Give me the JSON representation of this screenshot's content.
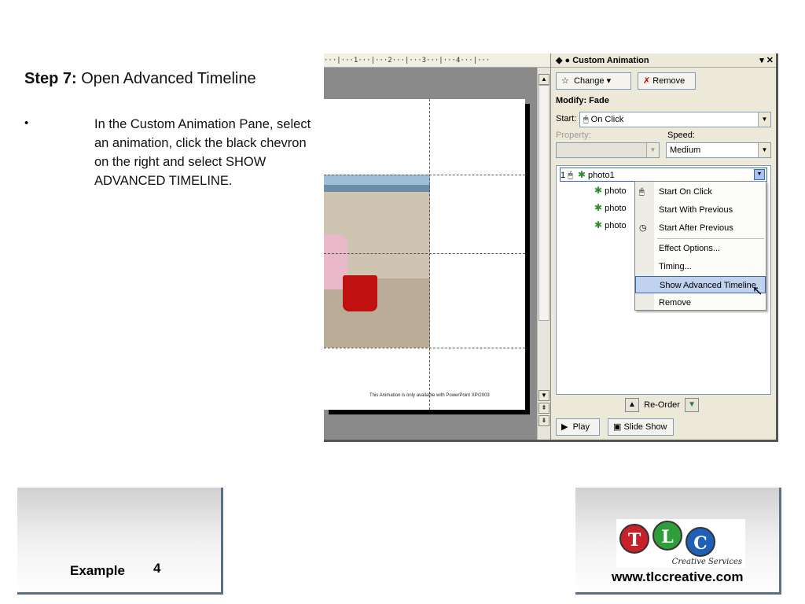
{
  "heading": {
    "step": "Step 7:",
    "title": "Open Advanced Timeline"
  },
  "bullet": {
    "marker": "•",
    "text": "In the Custom Animation Pane, select an animation, click the black chevron on the right and select SHOW ADVANCED TIMELINE."
  },
  "slide": {
    "caption": "This Animation is only available with PowerPoint XP/2003"
  },
  "pane": {
    "title": "Custom Animation",
    "change_label": "Change",
    "remove_label": "Remove",
    "modify_label": "Modify: Fade",
    "start_label": "Start:",
    "start_value": "On Click",
    "property_label": "Property:",
    "speed_label": "Speed:",
    "speed_value": "Medium",
    "list_items": [
      {
        "index": "1",
        "name": "photo1"
      },
      {
        "name": "photo"
      },
      {
        "name": "photo"
      },
      {
        "name": "photo"
      }
    ],
    "menu": [
      "Start On Click",
      "Start With Previous",
      "Start After Previous",
      "Effect Options...",
      "Timing...",
      "Show Advanced Timeline",
      "Remove"
    ],
    "reorder_label": "Re-Order",
    "play_label": "Play",
    "slideshow_label": "Slide Show"
  },
  "footer": {
    "example_label": "Example",
    "example_number": "4",
    "url": "www.tlccreative.com",
    "logo_subtitle": "Creative Services"
  }
}
